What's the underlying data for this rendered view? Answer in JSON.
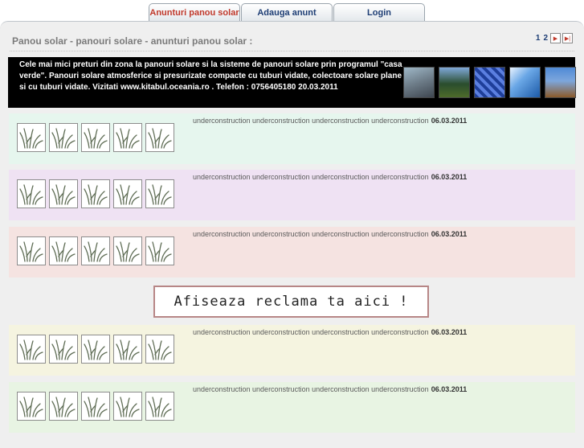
{
  "tabs": [
    {
      "label": "Anunturi panou solar"
    },
    {
      "label": "Adauga anunt"
    },
    {
      "label": "Login"
    }
  ],
  "header": {
    "title": "Panou solar - panouri solare - anunturi panou solar :"
  },
  "pager": {
    "pages": [
      "1",
      "2"
    ],
    "next_icon": "play-icon",
    "last_icon": "skip-forward-icon"
  },
  "banner": {
    "text": "Cele mai mici preturi din zona la panouri solare si la sisteme de panouri solare prin programul \"casa verde\". Panouri solare atmosferice si presurizate compacte cu tuburi vidate, colectoare solare plane si cu tuburi vidate. Vizitati www.kitabul.oceania.ro . Telefon : 0756405180  20.03.2011"
  },
  "listings": [
    {
      "text": "underconstruction underconstruction underconstruction underconstruction",
      "date": "06.03.2011",
      "bg": "#e6f6ee"
    },
    {
      "text": "underconstruction underconstruction underconstruction underconstruction",
      "date": "06.03.2011",
      "bg": "#efe2f3"
    },
    {
      "text": "underconstruction underconstruction underconstruction underconstruction",
      "date": "06.03.2011",
      "bg": "#f5e3e1"
    },
    {
      "text": "underconstruction underconstruction underconstruction underconstruction",
      "date": "06.03.2011",
      "bg": "#f5f4e0"
    },
    {
      "text": "underconstruction underconstruction underconstruction underconstruction",
      "date": "06.03.2011",
      "bg": "#e8f4e3"
    }
  ],
  "ad": {
    "label": "Afiseaza reclama ta aici !"
  }
}
